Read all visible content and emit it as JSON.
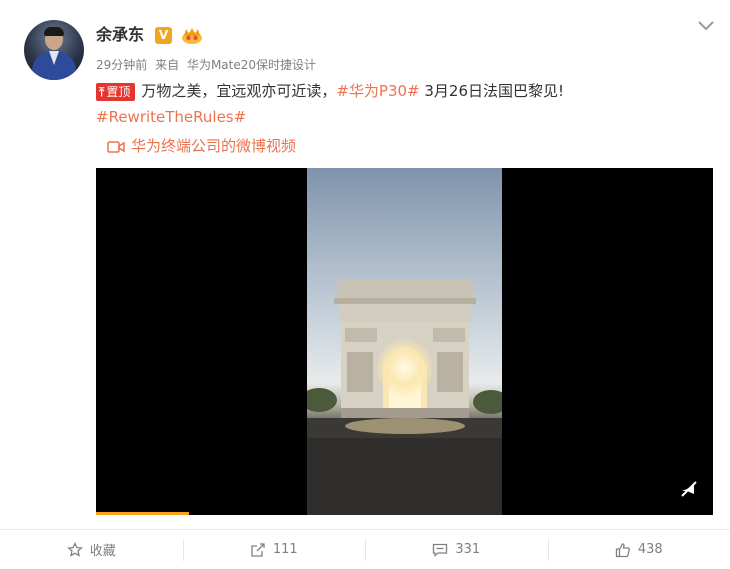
{
  "post": {
    "author": "余承东",
    "time": "29分钟前",
    "source_prefix": "来自",
    "source": "华为Mate20保时捷设计",
    "pin_label": "置顶",
    "text_main": "万物之美，宜远观亦可近读，",
    "topic": "#华为P30#",
    "text_tail": " 3月26日法国巴黎见!",
    "topic2": "#RewriteTheRules#",
    "video_link": "华为终端公司的微博视频"
  },
  "actions": {
    "favorite": "收藏",
    "repost": "111",
    "comment": "331",
    "like": "438"
  },
  "colors": {
    "accent": "#eb7350",
    "pin": "#e5352f",
    "progress": "#f7a21a",
    "vbadge": "#f3a520"
  },
  "video": {
    "progress_fraction": 0.15,
    "scene": "arc-de-triomphe"
  }
}
